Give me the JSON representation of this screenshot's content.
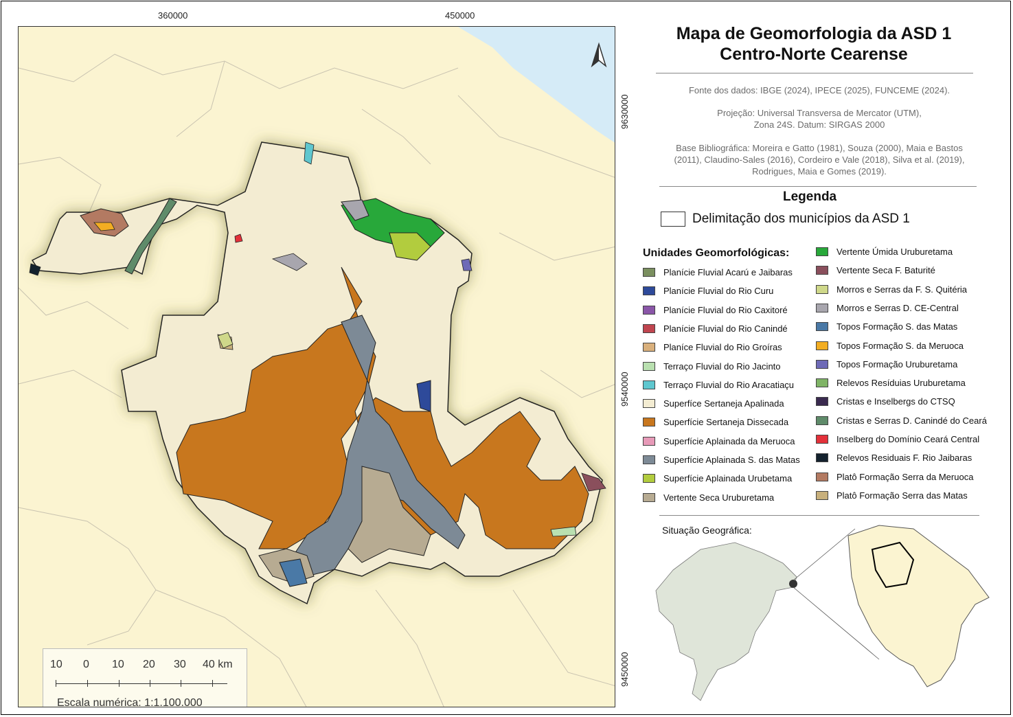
{
  "map": {
    "title_line1": "Mapa de Geomorfologia da ASD 1",
    "title_line2": "Centro-Norte Cearense",
    "coords_top": [
      "360000",
      "450000"
    ],
    "coords_right": [
      "9630000",
      "9540000",
      "9450000"
    ],
    "north_arrow": "north-arrow-icon"
  },
  "scale": {
    "labels": [
      "10",
      "0",
      "10",
      "20",
      "30",
      "40 km"
    ],
    "numeric": "Escala numérica: 1:1.100.000"
  },
  "info": {
    "sources": "Fonte dos dados: IBGE (2024), IPECE (2025), FUNCEME (2024).",
    "projection_line1": "Projeção: Universal Transversa de Mercator (UTM),",
    "projection_line2": "Zona 24S. Datum: SIRGAS 2000",
    "biblio_line1": "Base Bibliográfica: Moreira e Gatto (1981), Souza (2000), Maia e Bastos",
    "biblio_line2": "(2011), Claudino-Sales (2016), Cordeiro e Vale (2018), Silva et al. (2019),",
    "biblio_line3": "Rodrigues, Maia e Gomes (2019)."
  },
  "legend": {
    "title": "Legenda",
    "municipios": "Delimitação dos municípios da ASD 1",
    "units_title": "Unidades Geomorfológicas:",
    "col1": [
      {
        "label": "Planície Fluvial Acarú e Jaibaras",
        "color": "#7a8f5f"
      },
      {
        "label": "Planície Fluvial do Rio Curu",
        "color": "#2e4a9a"
      },
      {
        "label": "Planície Fluvial do Rio Caxitoré",
        "color": "#8a56a8"
      },
      {
        "label": "Planície Fluvial do Rio Canindé",
        "color": "#c0454f"
      },
      {
        "label": "Planíce Fluvial do Rio Groíras",
        "color": "#d9b07c"
      },
      {
        "label": "Terraço Fluvial do Rio Jacinto",
        "color": "#b9e0b0"
      },
      {
        "label": "Terraço Fluvial do Rio Aracatiaçu",
        "color": "#5fc7cf"
      },
      {
        "label": "Superfíce Sertaneja Apalinada",
        "color": "#f3ecd2"
      },
      {
        "label": "Superfície Sertaneja Dissecada",
        "color": "#c8771e"
      },
      {
        "label": "Superfície Aplainada da Meruoca",
        "color": "#e79ab8"
      },
      {
        "label": "Superfície Aplainada S. das Matas",
        "color": "#7d8a96"
      },
      {
        "label": "Superfície Aplainada Urubetama",
        "color": "#b2cc3e"
      },
      {
        "label": "Vertente Seca Uruburetama",
        "color": "#b7ab92"
      }
    ],
    "col2": [
      {
        "label": "Vertente Úmida Uruburetama",
        "color": "#28a83a"
      },
      {
        "label": "Vertente Seca F. Baturité",
        "color": "#8a4f5c"
      },
      {
        "label": "Morros e Serras da F. S. Quitéria",
        "color": "#cfd88a"
      },
      {
        "label": "Morros e Serras D. CE-Central",
        "color": "#a8a6ae"
      },
      {
        "label": "Topos Formação S. das Matas",
        "color": "#4a79a6"
      },
      {
        "label": "Topos Formação S. da Meruoca",
        "color": "#f2ad22"
      },
      {
        "label": "Topos Formação Uruburetama",
        "color": "#6e6ab7"
      },
      {
        "label": "Relevos Resíduias Uruburetama",
        "color": "#7fb466"
      },
      {
        "label": "Cristas e Inselbergs do CTSQ",
        "color": "#3a2a4f"
      },
      {
        "label": "Cristas e Serras D. Canindé do Ceará",
        "color": "#5f8b6a"
      },
      {
        "label": "Inselberg do Domínio Ceará Central",
        "color": "#e3313a"
      },
      {
        "label": "Relevos Residuais F. Rio Jaibaras",
        "color": "#14222e"
      },
      {
        "label": "Platô Formação Serra da Meruoca",
        "color": "#b37a62"
      },
      {
        "label": "Platô Formação Serra das Matas",
        "color": "#c8b07c"
      }
    ]
  },
  "situacao": {
    "label": "Situação Geográfica:"
  },
  "colors": {
    "background": "#fbf4d1",
    "ocean": "#d5ebf7",
    "border_lines": "#c9c3b0"
  }
}
